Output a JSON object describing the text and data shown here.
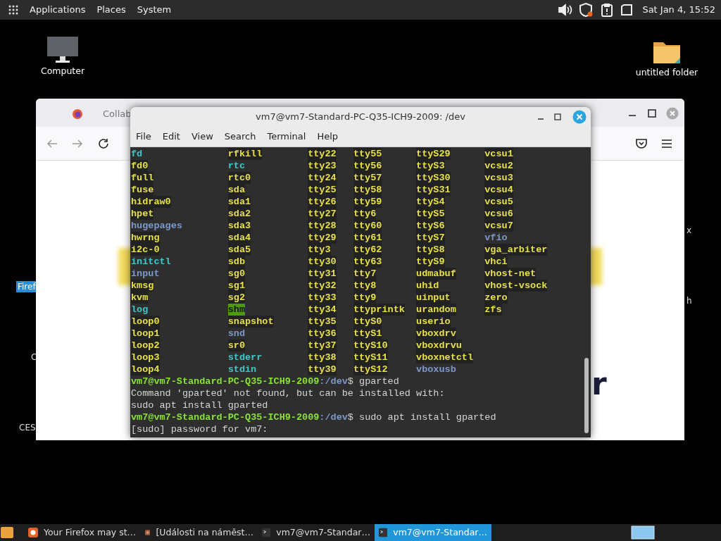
{
  "top_panel": {
    "menus": [
      "Applications",
      "Places",
      "System"
    ],
    "clock": "Sat Jan 4, 15:52"
  },
  "desktop_icons": [
    {
      "kind": "computer",
      "label": "Computer"
    },
    {
      "kind": "folder",
      "label": "untitled folder"
    }
  ],
  "desktop_labels": [
    {
      "text": "Firef",
      "selected": true
    },
    {
      "text": "C",
      "selected": false
    },
    {
      "text": "CES",
      "selected": false
    },
    {
      "text": "x",
      "selected": false
    },
    {
      "text": "h",
      "selected": false
    }
  ],
  "browser": {
    "tab_title": "Collab",
    "page_fragments": [
      "r"
    ]
  },
  "terminal": {
    "title": "vm7@vm7-Standard-PC-Q35-ICH9-2009: /dev",
    "menu": [
      "File",
      "Edit",
      "View",
      "Search",
      "Terminal",
      "Help"
    ],
    "listing": [
      [
        {
          "text": "fd",
          "kind": "link"
        },
        {
          "text": "rfkill",
          "kind": "device"
        },
        {
          "text": "tty22",
          "kind": "device"
        },
        {
          "text": "tty55",
          "kind": "device"
        },
        {
          "text": "ttyS29",
          "kind": "device"
        },
        {
          "text": "vcsu1",
          "kind": "device"
        }
      ],
      [
        {
          "text": "fd0",
          "kind": "device"
        },
        {
          "text": "rtc",
          "kind": "link"
        },
        {
          "text": "tty23",
          "kind": "device"
        },
        {
          "text": "tty56",
          "kind": "device"
        },
        {
          "text": "ttyS3",
          "kind": "device"
        },
        {
          "text": "vcsu2",
          "kind": "device"
        }
      ],
      [
        {
          "text": "full",
          "kind": "device"
        },
        {
          "text": "rtc0",
          "kind": "device"
        },
        {
          "text": "tty24",
          "kind": "device"
        },
        {
          "text": "tty57",
          "kind": "device"
        },
        {
          "text": "ttyS30",
          "kind": "device"
        },
        {
          "text": "vcsu3",
          "kind": "device"
        }
      ],
      [
        {
          "text": "fuse",
          "kind": "device"
        },
        {
          "text": "sda",
          "kind": "device"
        },
        {
          "text": "tty25",
          "kind": "device"
        },
        {
          "text": "tty58",
          "kind": "device"
        },
        {
          "text": "ttyS31",
          "kind": "device"
        },
        {
          "text": "vcsu4",
          "kind": "device"
        }
      ],
      [
        {
          "text": "hidraw0",
          "kind": "device"
        },
        {
          "text": "sda1",
          "kind": "device"
        },
        {
          "text": "tty26",
          "kind": "device"
        },
        {
          "text": "tty59",
          "kind": "device"
        },
        {
          "text": "ttyS4",
          "kind": "device"
        },
        {
          "text": "vcsu5",
          "kind": "device"
        }
      ],
      [
        {
          "text": "hpet",
          "kind": "device"
        },
        {
          "text": "sda2",
          "kind": "device"
        },
        {
          "text": "tty27",
          "kind": "device"
        },
        {
          "text": "tty6",
          "kind": "device"
        },
        {
          "text": "ttyS5",
          "kind": "device"
        },
        {
          "text": "vcsu6",
          "kind": "device"
        }
      ],
      [
        {
          "text": "hugepages",
          "kind": "dir"
        },
        {
          "text": "sda3",
          "kind": "device"
        },
        {
          "text": "tty28",
          "kind": "device"
        },
        {
          "text": "tty60",
          "kind": "device"
        },
        {
          "text": "ttyS6",
          "kind": "device"
        },
        {
          "text": "vcsu7",
          "kind": "device"
        }
      ],
      [
        {
          "text": "hwrng",
          "kind": "device"
        },
        {
          "text": "sda4",
          "kind": "device"
        },
        {
          "text": "tty29",
          "kind": "device"
        },
        {
          "text": "tty61",
          "kind": "device"
        },
        {
          "text": "ttyS7",
          "kind": "device"
        },
        {
          "text": "vfio",
          "kind": "dir"
        }
      ],
      [
        {
          "text": "i2c-0",
          "kind": "device"
        },
        {
          "text": "sda5",
          "kind": "device"
        },
        {
          "text": "tty3",
          "kind": "device"
        },
        {
          "text": "tty62",
          "kind": "device"
        },
        {
          "text": "ttyS8",
          "kind": "device"
        },
        {
          "text": "vga_arbiter",
          "kind": "device"
        }
      ],
      [
        {
          "text": "initctl",
          "kind": "link"
        },
        {
          "text": "sdb",
          "kind": "device"
        },
        {
          "text": "tty30",
          "kind": "device"
        },
        {
          "text": "tty63",
          "kind": "device"
        },
        {
          "text": "ttyS9",
          "kind": "device"
        },
        {
          "text": "vhci",
          "kind": "device"
        }
      ],
      [
        {
          "text": "input",
          "kind": "dir"
        },
        {
          "text": "sg0",
          "kind": "device"
        },
        {
          "text": "tty31",
          "kind": "device"
        },
        {
          "text": "tty7",
          "kind": "device"
        },
        {
          "text": "udmabuf",
          "kind": "device"
        },
        {
          "text": "vhost-net",
          "kind": "device"
        }
      ],
      [
        {
          "text": "kmsg",
          "kind": "device"
        },
        {
          "text": "sg1",
          "kind": "device"
        },
        {
          "text": "tty32",
          "kind": "device"
        },
        {
          "text": "tty8",
          "kind": "device"
        },
        {
          "text": "uhid",
          "kind": "device"
        },
        {
          "text": "vhost-vsock",
          "kind": "device"
        }
      ],
      [
        {
          "text": "kvm",
          "kind": "device"
        },
        {
          "text": "sg2",
          "kind": "device"
        },
        {
          "text": "tty33",
          "kind": "device"
        },
        {
          "text": "tty9",
          "kind": "device"
        },
        {
          "text": "uinput",
          "kind": "device"
        },
        {
          "text": "zero",
          "kind": "device"
        }
      ],
      [
        {
          "text": "log",
          "kind": "link"
        },
        {
          "text": "shm",
          "kind": "sticky"
        },
        {
          "text": "tty34",
          "kind": "device"
        },
        {
          "text": "ttyprintk",
          "kind": "device"
        },
        {
          "text": "urandom",
          "kind": "device"
        },
        {
          "text": "zfs",
          "kind": "device"
        }
      ],
      [
        {
          "text": "loop0",
          "kind": "device"
        },
        {
          "text": "snapshot",
          "kind": "device"
        },
        {
          "text": "tty35",
          "kind": "device"
        },
        {
          "text": "ttyS0",
          "kind": "device"
        },
        {
          "text": "userio",
          "kind": "device"
        }
      ],
      [
        {
          "text": "loop1",
          "kind": "device"
        },
        {
          "text": "snd",
          "kind": "dir"
        },
        {
          "text": "tty36",
          "kind": "device"
        },
        {
          "text": "ttyS1",
          "kind": "device"
        },
        {
          "text": "vboxdrv",
          "kind": "device"
        }
      ],
      [
        {
          "text": "loop2",
          "kind": "device"
        },
        {
          "text": "sr0",
          "kind": "device"
        },
        {
          "text": "tty37",
          "kind": "device"
        },
        {
          "text": "ttyS10",
          "kind": "device"
        },
        {
          "text": "vboxdrvu",
          "kind": "device"
        }
      ],
      [
        {
          "text": "loop3",
          "kind": "device"
        },
        {
          "text": "stderr",
          "kind": "link"
        },
        {
          "text": "tty38",
          "kind": "device"
        },
        {
          "text": "ttyS11",
          "kind": "device"
        },
        {
          "text": "vboxnetctl",
          "kind": "device"
        }
      ],
      [
        {
          "text": "loop4",
          "kind": "device"
        },
        {
          "text": "stdin",
          "kind": "link"
        },
        {
          "text": "tty39",
          "kind": "device"
        },
        {
          "text": "ttyS12",
          "kind": "device"
        },
        {
          "text": "vboxusb",
          "kind": "dir"
        }
      ]
    ],
    "lines": [
      {
        "kind": "prompt",
        "user_host": "vm7@vm7-Standard-PC-Q35-ICH9-2009",
        "path": ":/dev",
        "command": "$ gparted"
      },
      {
        "kind": "output",
        "text": "Command 'gparted' not found, but can be installed with:"
      },
      {
        "kind": "output",
        "text": "sudo apt install gparted"
      },
      {
        "kind": "prompt",
        "user_host": "vm7@vm7-Standard-PC-Q35-ICH9-2009",
        "path": ":/dev",
        "command": "$ sudo apt install gparted"
      },
      {
        "kind": "output",
        "text": "[sudo] password for vm7:"
      }
    ]
  },
  "taskbar": {
    "tasks": [
      {
        "kind": "firefox",
        "label": "Your Firefox may st…",
        "selected": false
      },
      {
        "kind": "browser",
        "label": "[Události na náměst…",
        "selected": false
      },
      {
        "kind": "terminal",
        "label": "vm7@vm7-Standar…",
        "selected": false
      },
      {
        "kind": "terminal",
        "label": "vm7@vm7-Standar…",
        "selected": true
      }
    ]
  }
}
